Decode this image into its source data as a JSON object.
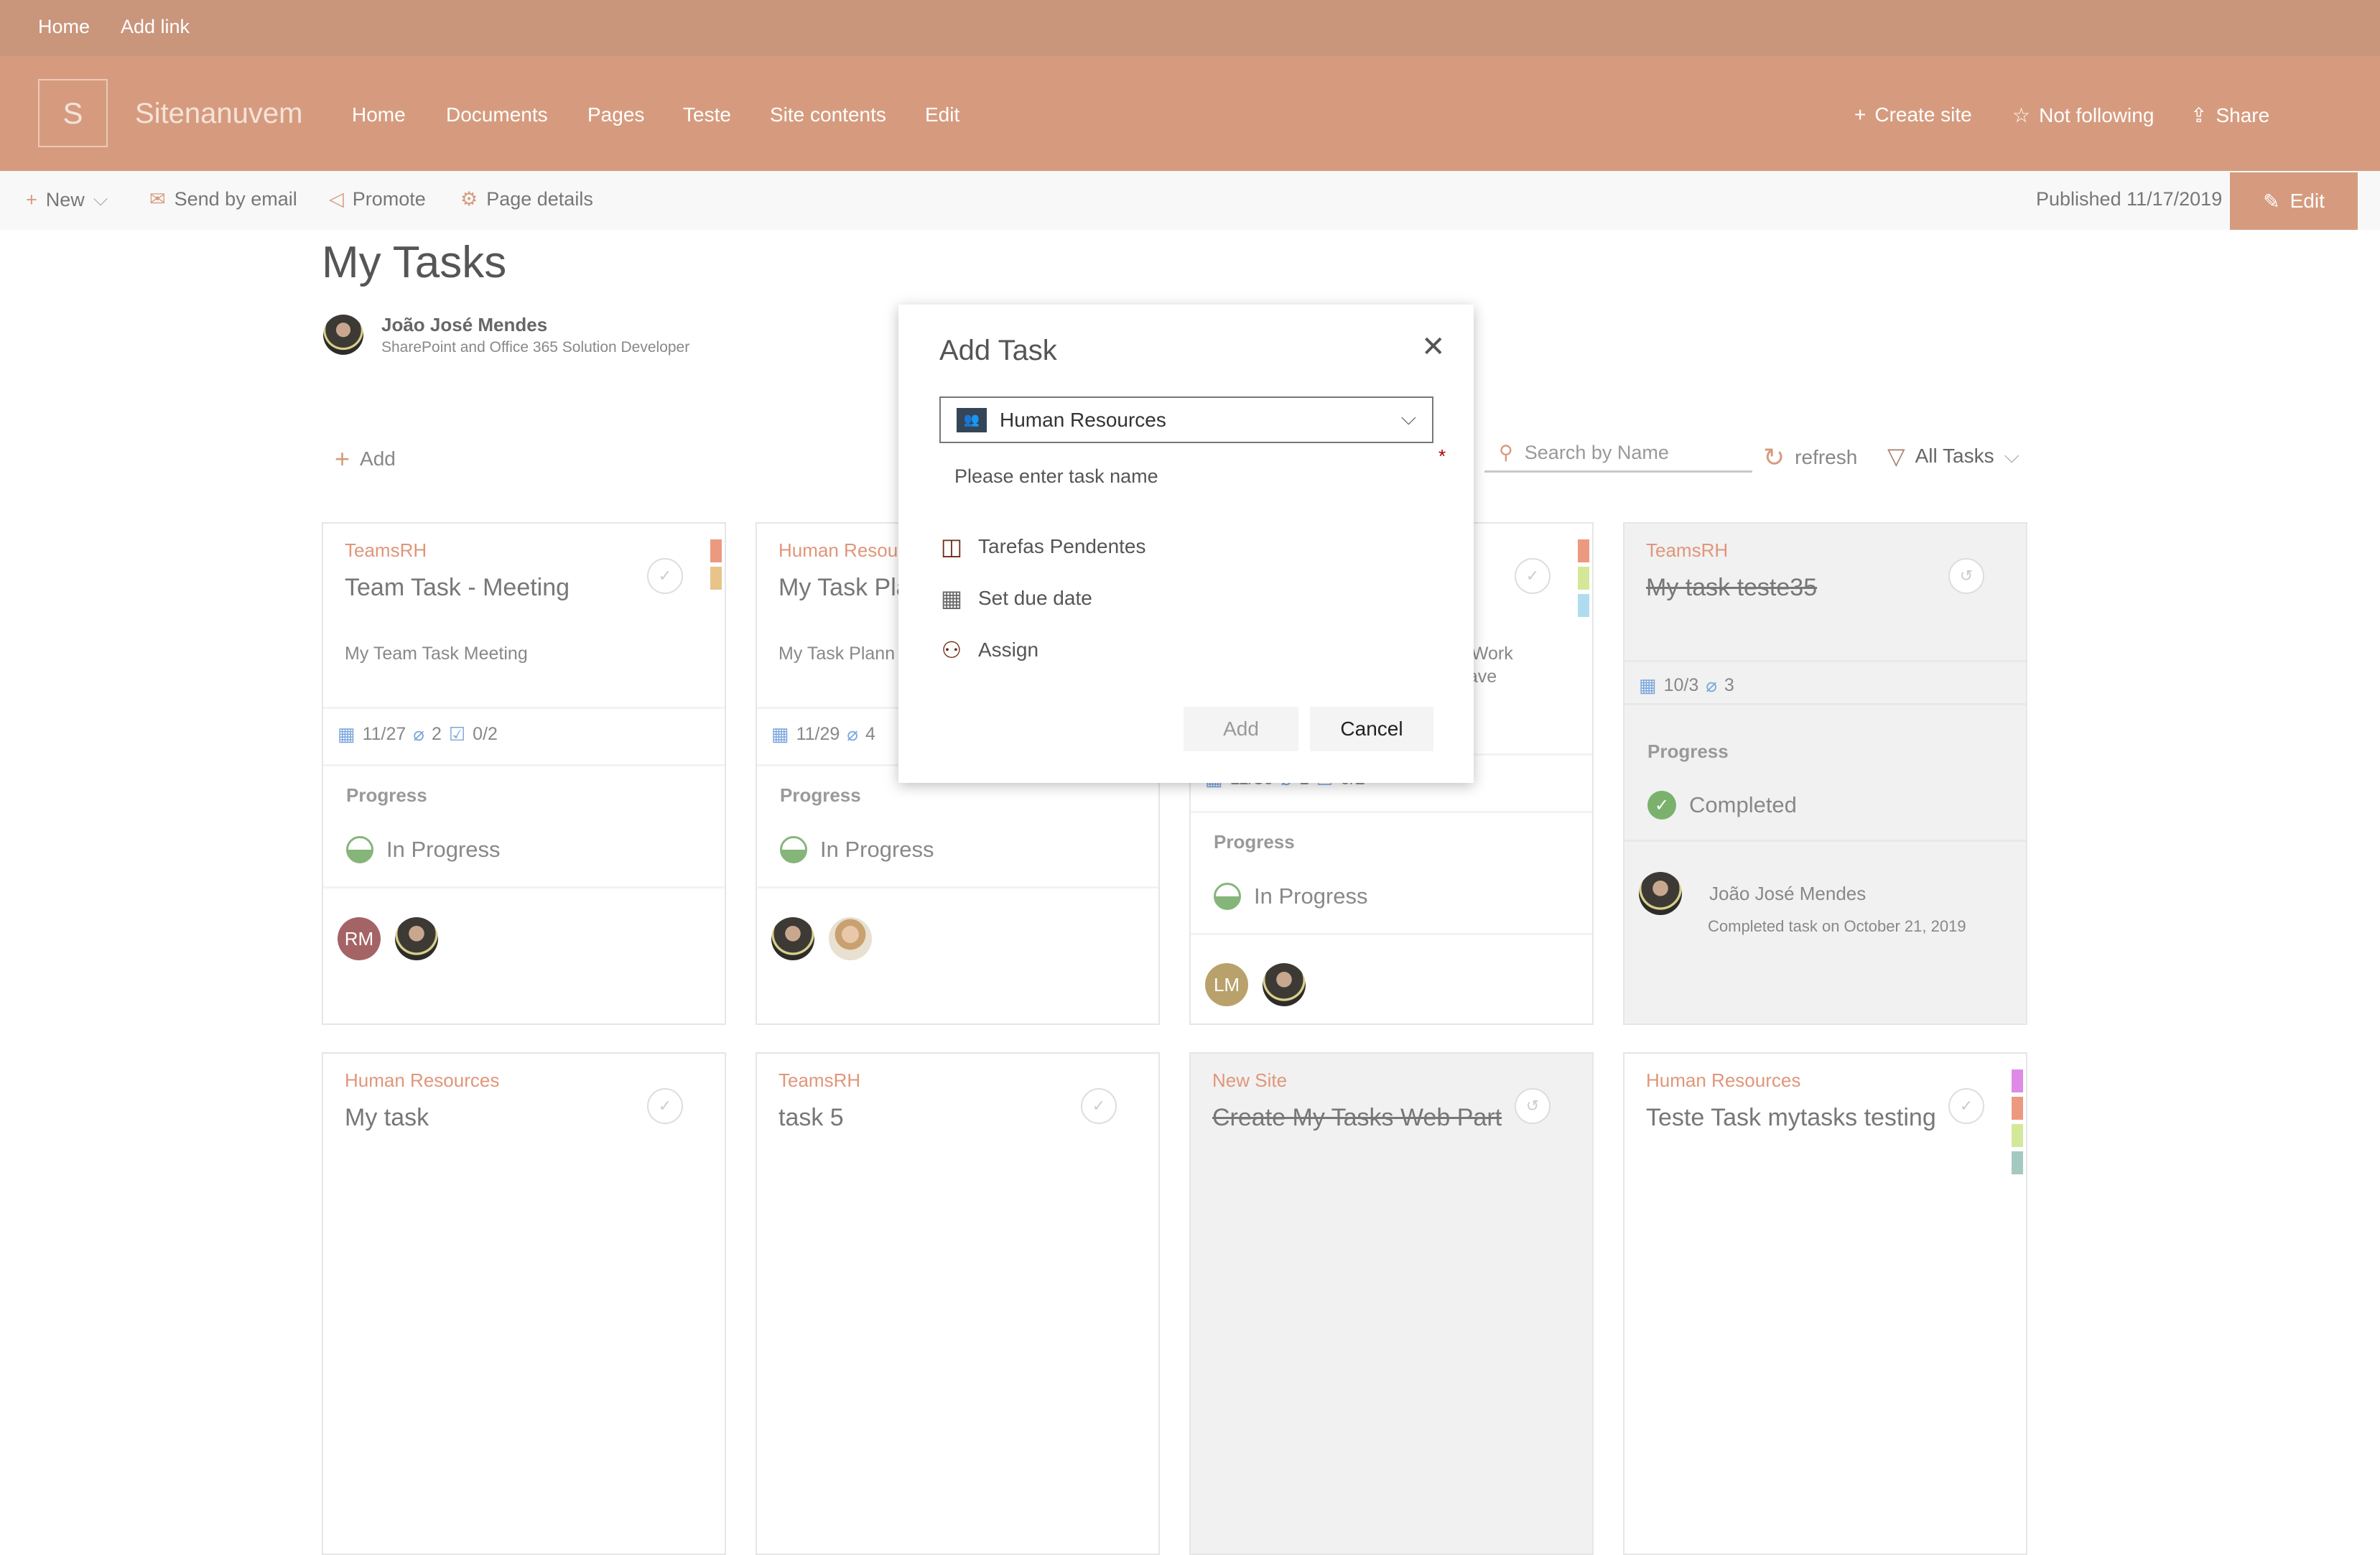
{
  "suitebar": {
    "links": [
      "Home",
      "Add link"
    ]
  },
  "header": {
    "logo_letter": "S",
    "site_name": "Sitenanuvem",
    "nav": [
      "Home",
      "Documents",
      "Pages",
      "Teste",
      "Site contents",
      "Edit"
    ],
    "actions": {
      "create_site": "Create site",
      "follow": "Not following",
      "share": "Share"
    }
  },
  "commandbar": {
    "new": "New",
    "send": "Send by email",
    "promote": "Promote",
    "details": "Page details",
    "published": "Published 11/17/2019",
    "edit": "Edit"
  },
  "page": {
    "title": "My Tasks",
    "author_name": "João José Mendes",
    "author_role": "SharePoint and Office 365 Solution Developer"
  },
  "toolbar": {
    "add": "Add",
    "search_placeholder": "Search by Name",
    "refresh": "refresh",
    "filter": "All Tasks"
  },
  "colors": {
    "accent": "#d69b7e",
    "suitebar": "#c9957b",
    "progress": "#86b57a",
    "required": "#a80000"
  },
  "cards": [
    {
      "category": "TeamsRH",
      "title": "Team Task - Meeting",
      "description": "My Team Task Meeting",
      "due": "11/27",
      "attachments": "2",
      "checklist": "0/2",
      "progress_label": "Progress",
      "status": "In Progress",
      "assignees": [
        "RM"
      ]
    },
    {
      "category": "Human Resou",
      "title": "My Task Pla",
      "description": "My Task Plann",
      "due": "11/29",
      "attachments": "4",
      "progress_label": "Progress",
      "status": "In Progress"
    },
    {
      "description_lines": [
        "t, Work",
        "eave"
      ],
      "due": "11/30",
      "attachments": "1",
      "checklist": "0/2",
      "progress_label": "Progress",
      "status": "In Progress",
      "assignees": [
        "LM"
      ]
    },
    {
      "category": "TeamsRH",
      "title": "My task teste35",
      "due": "10/3",
      "attachments": "3",
      "progress_label": "Progress",
      "status": "Completed",
      "completed_by": "João José Mendes",
      "completed_on": "Completed task on October 21, 2019"
    },
    {
      "category": "Human Resources",
      "title": "My task"
    },
    {
      "category": "TeamsRH",
      "title": "task 5"
    },
    {
      "category": "New Site",
      "title": "Create My Tasks Web Part"
    },
    {
      "category": "Human Resources",
      "title": "Teste Task mytasks testing"
    }
  ],
  "modal": {
    "title": "Add Task",
    "group": "Human Resources",
    "required_mark": "*",
    "task_name_placeholder": "Please enter task name",
    "bucket": "Tarefas Pendentes",
    "due": "Set due date",
    "assign": "Assign",
    "add": "Add",
    "cancel": "Cancel"
  }
}
